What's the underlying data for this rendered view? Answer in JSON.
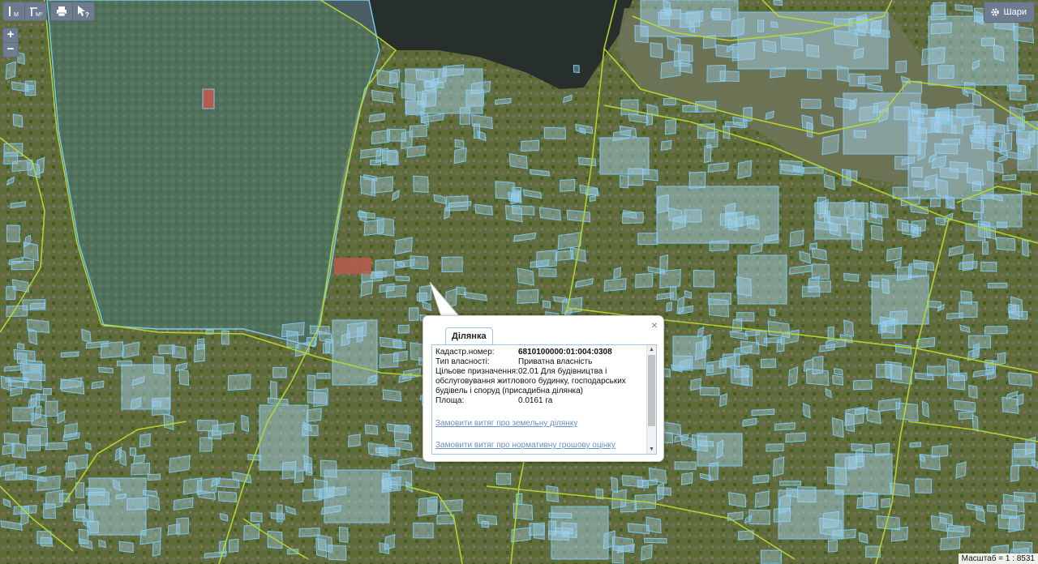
{
  "toolbar": {
    "tools": [
      {
        "name": "measure-length-tool",
        "icon": "ruler-vertical-icon",
        "label": "l"
      },
      {
        "name": "measure-area-tool",
        "icon": "ruler-area-icon",
        "label": "m²"
      },
      {
        "name": "print-tool",
        "icon": "print-icon"
      },
      {
        "name": "identify-tool",
        "icon": "cursor-help-icon",
        "label": "?"
      }
    ]
  },
  "zoom": {
    "in_label": "+",
    "out_label": "−"
  },
  "layers_button": {
    "label": "Шари",
    "icon": "gear-icon"
  },
  "popup": {
    "tab_label": "Ділянка",
    "close_label": "×",
    "fields": [
      {
        "key": "Кадастр.номер:",
        "value": "6810100000:01:004:0308"
      },
      {
        "key": "Тип власності:",
        "value": "Приватна власність"
      },
      {
        "key": "Цільове призначення:",
        "value": "02.01 Для будівництва і обслуговування житлового будинку, господарських будівель і споруд (присадибна ділянка)"
      },
      {
        "key": "Площа:",
        "value": "0.0161 га"
      }
    ],
    "links": [
      "Замовити витяг про земельну ділянку",
      "Замовити витяг про нормативну грошову оцінку"
    ]
  },
  "scale": {
    "label": "Масштаб = 1 : 8531"
  },
  "colors": {
    "parcel_stroke": "#7cc7f0",
    "parcel_fill": "#a9d7f5",
    "boundary_line": "#b7d932",
    "water": "#262f2c",
    "forest": "#2f4a1f"
  }
}
